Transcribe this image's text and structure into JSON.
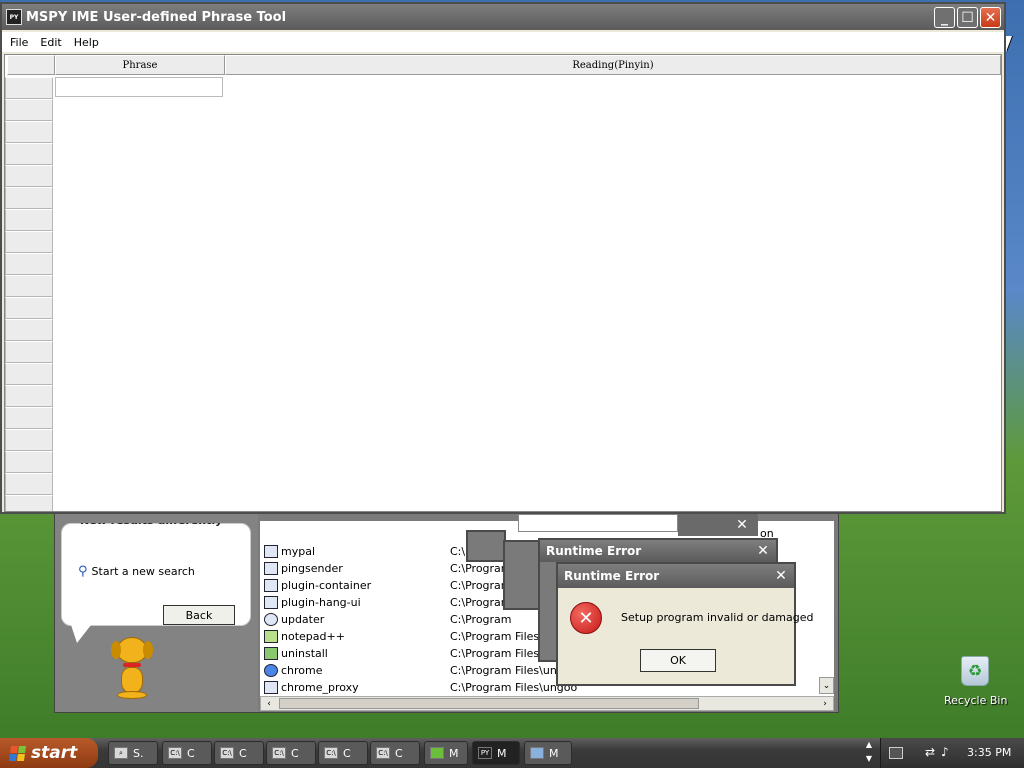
{
  "main_window": {
    "title": "MSPY IME User-defined Phrase Tool",
    "menu": [
      "File",
      "Edit",
      "Help"
    ],
    "columns": [
      "Phrase",
      "Reading(Pinyin)"
    ]
  },
  "search_companion": {
    "truncated_heading": "New results differently",
    "start_new_search": "Start a new search",
    "back_button": "Back"
  },
  "results": [
    {
      "name": "mypal",
      "path": "C:\\P"
    },
    {
      "name": "pingsender",
      "path": "C:\\Program"
    },
    {
      "name": "plugin-container",
      "path": "C:\\Program"
    },
    {
      "name": "plugin-hang-ui",
      "path": "C:\\Program"
    },
    {
      "name": "updater",
      "path": "C:\\Program"
    },
    {
      "name": "notepad++",
      "path": "C:\\Program Files"
    },
    {
      "name": "uninstall",
      "path": "C:\\Program Files\\No"
    },
    {
      "name": "chrome",
      "path": "C:\\Program Files\\ungoo"
    },
    {
      "name": "chrome_proxy",
      "path": "C:\\Program Files\\ungoo"
    }
  ],
  "partial_text": "on",
  "dialogs": {
    "runtime_error_back_title": "Runtime Error",
    "runtime_error_title": "Runtime Error",
    "message": "Setup program invalid or damaged",
    "ok_label": "OK"
  },
  "desktop": {
    "recycle_bin_label": "Recycle Bin"
  },
  "taskbar": {
    "start_label": "start",
    "buttons": [
      "S.",
      "C",
      "C",
      "C",
      "C",
      "C",
      "M",
      "M",
      "M"
    ],
    "clock": "3:35 PM"
  },
  "colors": {
    "error_red": "#d8242a",
    "title_blue": "#1a4ab8",
    "start_orange": "#a9491a"
  }
}
